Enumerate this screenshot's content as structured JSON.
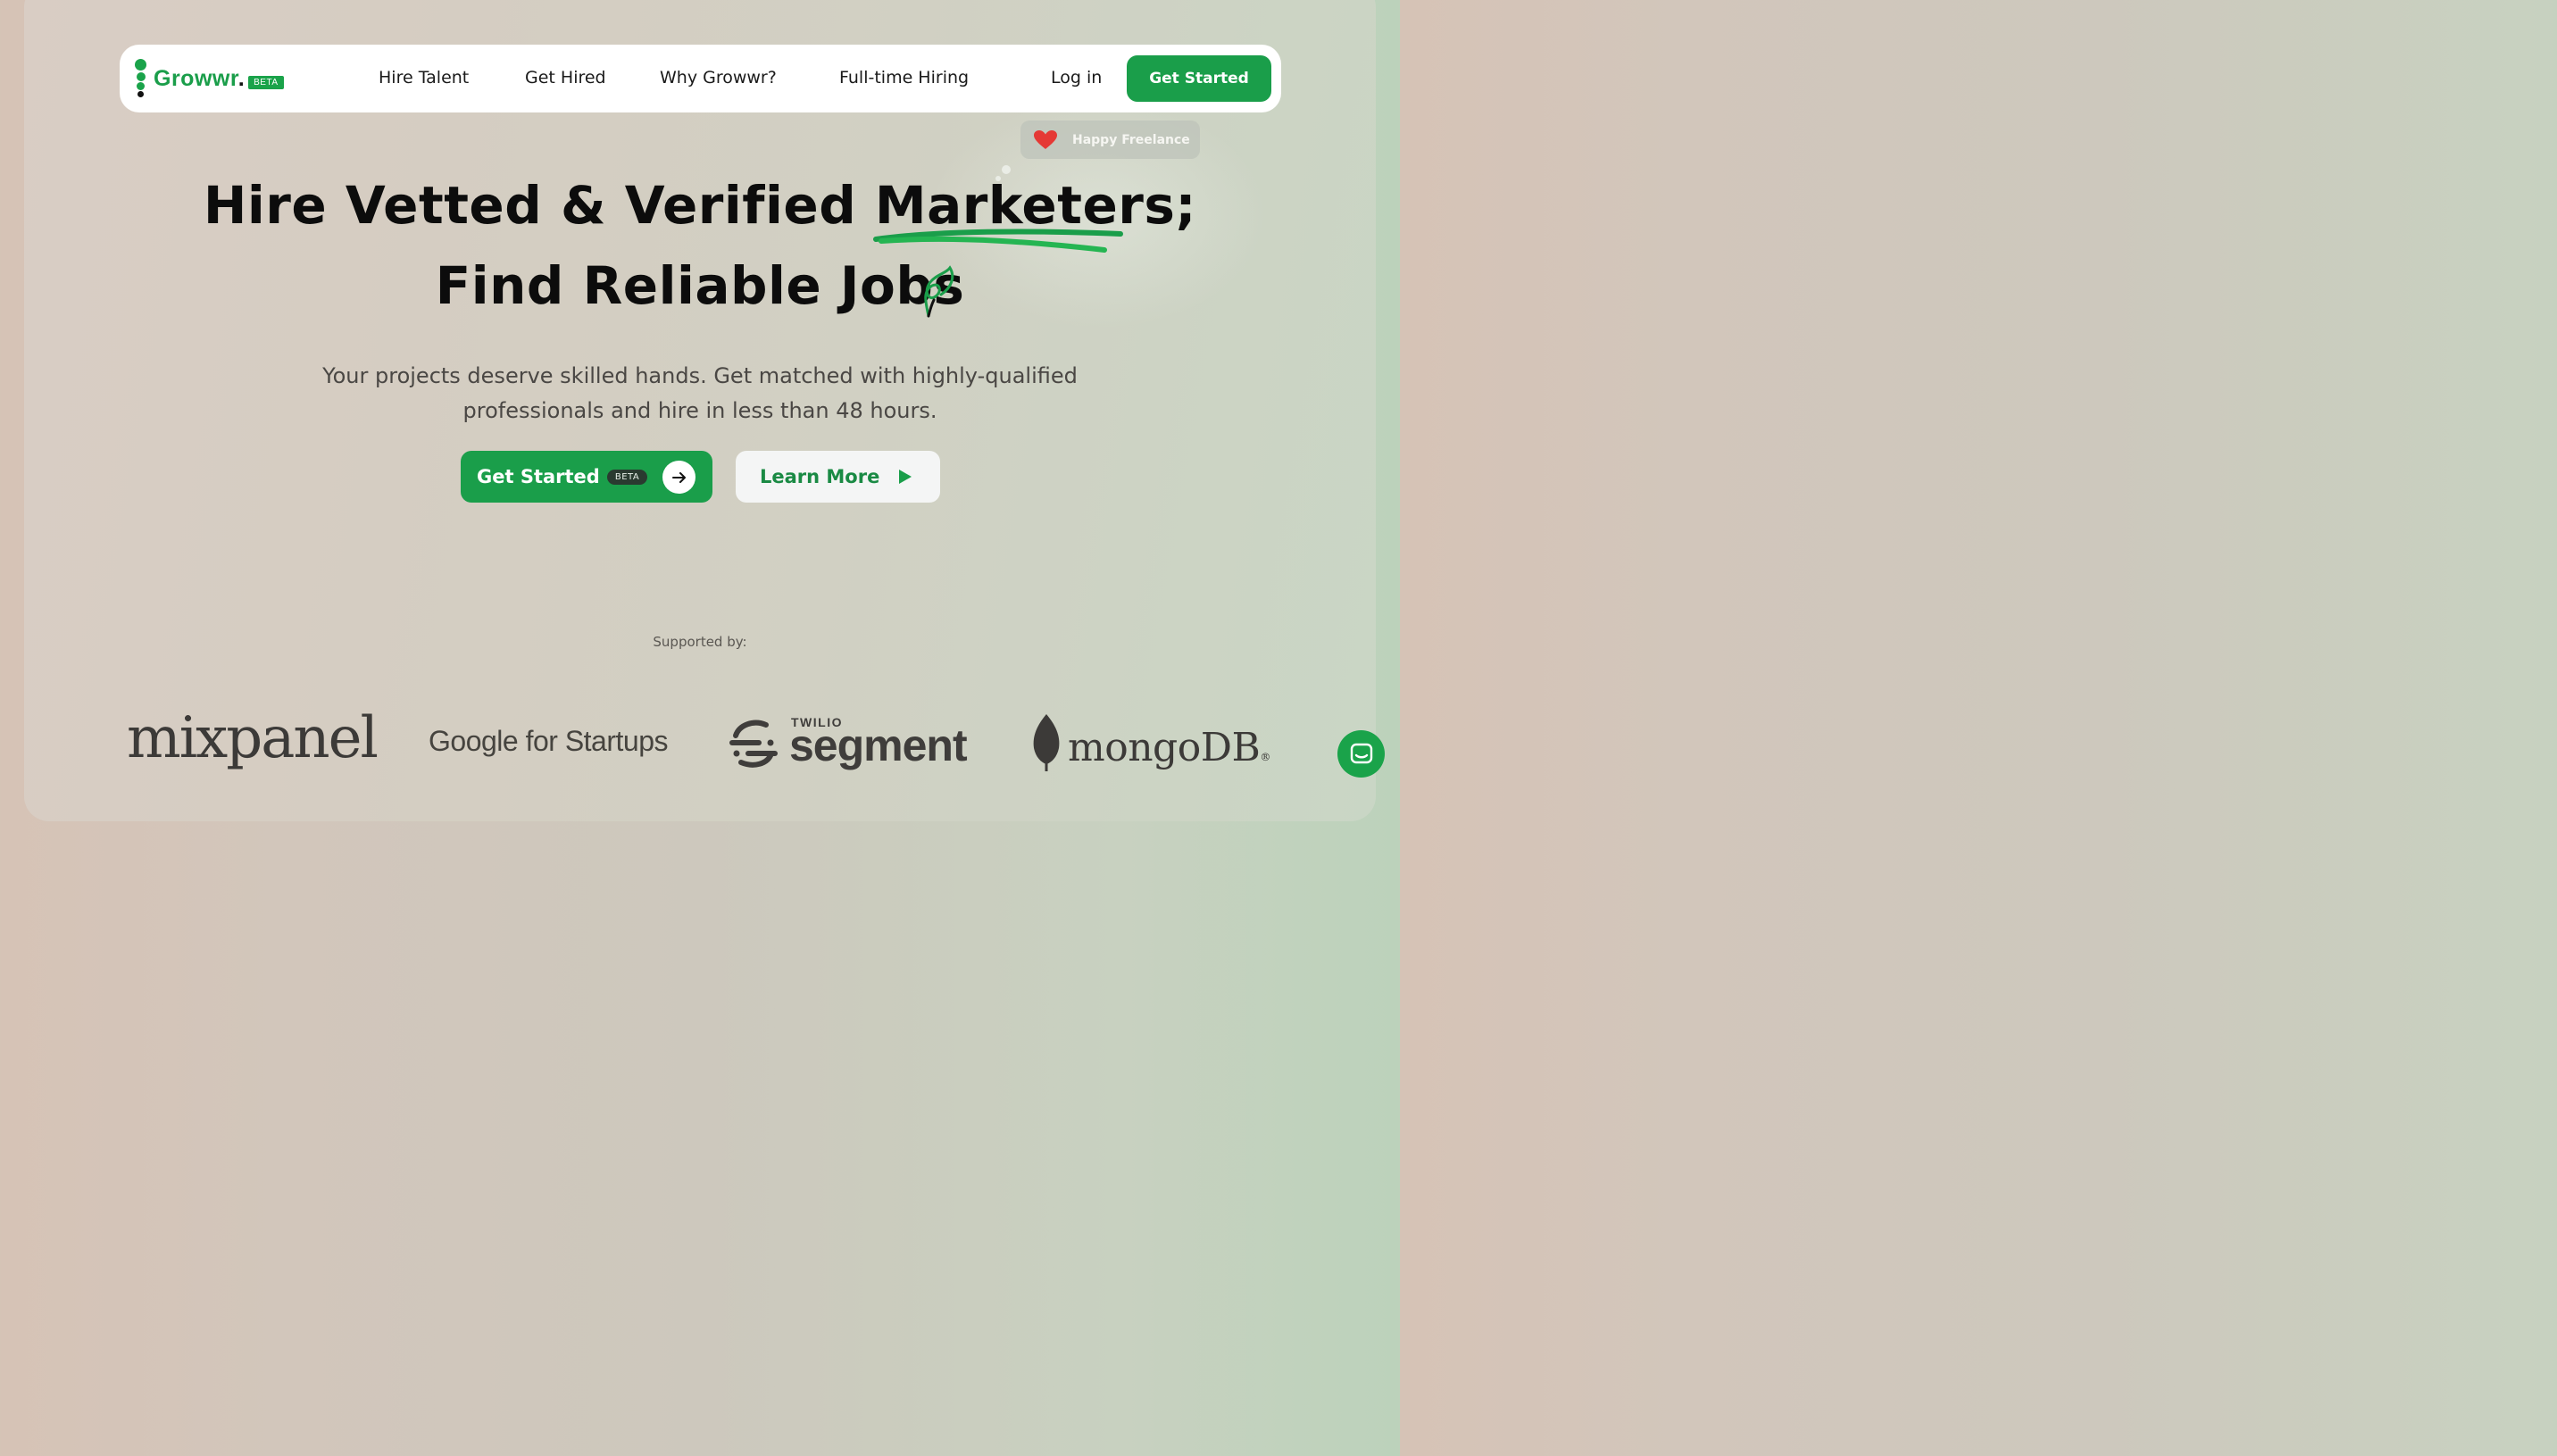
{
  "nav": {
    "brand": "Growwr",
    "brand_dot": ".",
    "brand_badge": "BETA",
    "links": [
      "Hire Talent",
      "Get Hired",
      "Why Growwr?",
      "Full-time Hiring"
    ],
    "login_label": "Log in",
    "cta_label": "Get Started"
  },
  "chip": {
    "text": "Happy Freelance",
    "icon": "heart-icon"
  },
  "hero": {
    "line1": "Hire Vetted & Verified Marketers;",
    "line2": "Find Reliable Jobs",
    "subtitle": "Your projects deserve skilled hands. Get matched with highly-qualified professionals and hire in less than 48 hours.",
    "primary_label": "Get Started",
    "primary_badge": "BETA",
    "secondary_label": "Learn More"
  },
  "supported": {
    "label": "Supported by:",
    "logos": {
      "mixpanel": "mixpanel",
      "google": "Google for Startups",
      "segment_top": "TWILIO",
      "segment": "segment",
      "mongodb": "mongoDB",
      "mongodb_mark": "®"
    }
  },
  "colors": {
    "brand_green": "#1a9e4a",
    "text_dark": "#0c0c0c",
    "chip_bg": "#bec3b9"
  },
  "icons": [
    "arrow-right-icon",
    "play-icon",
    "chat-icon",
    "sprout-icon",
    "heart-icon"
  ]
}
